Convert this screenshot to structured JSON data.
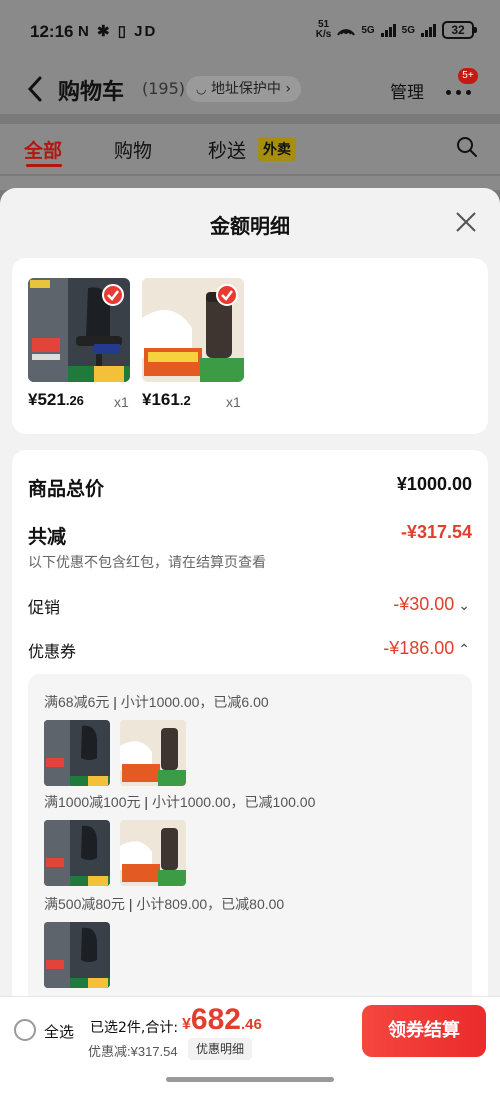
{
  "status_bar": {
    "time": "12:16",
    "left_icons": "N ✱ ▯ JD",
    "net_speed_value": "51",
    "net_speed_unit": "K/s",
    "sig1_label": "5G",
    "sig2_label": "5G",
    "battery": "32"
  },
  "header": {
    "title": "购物车",
    "count": "(195)",
    "address": "地址保护中 ›",
    "manage": "管理",
    "badge": "5+"
  },
  "tabs": [
    {
      "label": "全部",
      "active": true
    },
    {
      "label": "购物"
    },
    {
      "label": "秒送"
    }
  ],
  "waimai_badge": "外卖",
  "sheet": {
    "title": "金额明细",
    "products": [
      {
        "name": "chair",
        "price_int": "¥521",
        "price_dec": ".26",
        "qty": "x1"
      },
      {
        "name": "thermos",
        "price_int": "¥161",
        "price_dec": ".2",
        "qty": "x1"
      }
    ],
    "total_label": "商品总价",
    "total_value": "¥1000.00",
    "reduce_label": "共减",
    "reduce_value": "-¥317.54",
    "reduce_note": "以下优惠不包含红包，请在结算页查看",
    "promo_label": "促销",
    "promo_value": "-¥30.00",
    "coupon_label": "优惠券",
    "coupon_value": "-¥186.00",
    "coupons": [
      {
        "rule": "满68减6元",
        "detail": "小计1000.00，已减6.00"
      },
      {
        "rule": "满1000减100元",
        "detail": "小计1000.00，已减100.00"
      },
      {
        "rule": "满500减80元",
        "detail": "小计809.00，已减80.00"
      }
    ]
  },
  "bottom_bar": {
    "select_all": "全选",
    "summary": "已选2件,合计:",
    "total_cur": "¥",
    "total_int": "682",
    "total_dec": ".46",
    "discount": "优惠减:¥317.54",
    "detail_chip": "优惠明细",
    "checkout": "领券结算"
  },
  "colors": {
    "accent_red": "#e23e2f",
    "overlay_gray": "#8a8a8a"
  }
}
